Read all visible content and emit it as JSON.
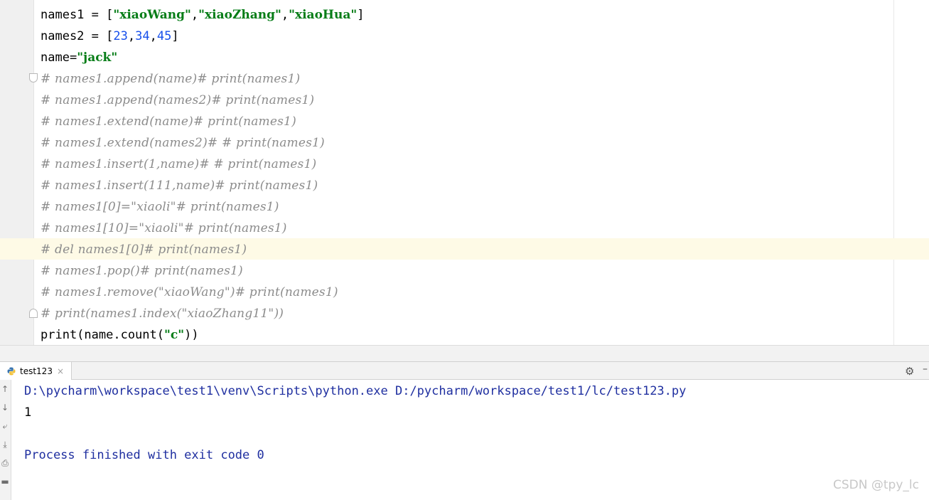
{
  "editor": {
    "lines": [
      {
        "parts": [
          {
            "t": "names1 = [",
            "c": ""
          },
          {
            "t": "\"xiaoWang\"",
            "c": "str"
          },
          {
            "t": ",",
            "c": ""
          },
          {
            "t": "\"xiaoZhang\"",
            "c": "str"
          },
          {
            "t": ",",
            "c": ""
          },
          {
            "t": "\"xiaoHua\"",
            "c": "str"
          },
          {
            "t": "]",
            "c": ""
          }
        ]
      },
      {
        "parts": [
          {
            "t": "names2 = [",
            "c": ""
          },
          {
            "t": "23",
            "c": "num"
          },
          {
            "t": ",",
            "c": ""
          },
          {
            "t": "34",
            "c": "num"
          },
          {
            "t": ",",
            "c": ""
          },
          {
            "t": "45",
            "c": "num"
          },
          {
            "t": "]",
            "c": ""
          }
        ]
      },
      {
        "parts": [
          {
            "t": "name=",
            "c": ""
          },
          {
            "t": "\"jack\"",
            "c": "str"
          }
        ]
      },
      {
        "parts": [
          {
            "t": "# names1.append(name)# print(names1)",
            "c": "comment"
          }
        ]
      },
      {
        "parts": [
          {
            "t": "# names1.append(names2)# print(names1)",
            "c": "comment"
          }
        ]
      },
      {
        "parts": [
          {
            "t": "# names1.extend(name)# print(names1)",
            "c": "comment"
          }
        ]
      },
      {
        "parts": [
          {
            "t": "# names1.extend(names2)# # print(names1)",
            "c": "comment"
          }
        ]
      },
      {
        "parts": [
          {
            "t": "# names1.insert(1,name)# # print(names1)",
            "c": "comment"
          }
        ]
      },
      {
        "parts": [
          {
            "t": "# names1.insert(111,name)# print(names1)",
            "c": "comment"
          }
        ]
      },
      {
        "parts": [
          {
            "t": "# names1[0]=\"xiaoli\"# print(names1)",
            "c": "comment"
          }
        ]
      },
      {
        "parts": [
          {
            "t": "# names1[10]=\"xiaoli\"# print(names1)",
            "c": "comment"
          }
        ]
      },
      {
        "parts": [
          {
            "t": "# del names1[0]# print(names1)",
            "c": "comment"
          }
        ]
      },
      {
        "parts": [
          {
            "t": "# names1.pop()# print(names1)",
            "c": "comment"
          }
        ]
      },
      {
        "parts": [
          {
            "t": "# names1.remove(\"xiaoWang\")# print(names1)",
            "c": "comment"
          }
        ]
      },
      {
        "parts": [
          {
            "t": "# print(names1.index(\"xiaoZhang11\"))",
            "c": "comment"
          }
        ]
      },
      {
        "parts": [
          {
            "t": "print(name.count(",
            "c": ""
          },
          {
            "t": "\"c\"",
            "c": "str"
          },
          {
            "t": "))",
            "c": ""
          }
        ]
      }
    ]
  },
  "run_panel": {
    "tab_label": "test123",
    "tab_close": "×",
    "icons": {
      "tab": "python-icon",
      "settings": "gear-icon",
      "hide": "minimize-icon"
    },
    "output": {
      "command": "D:\\pycharm\\workspace\\test1\\venv\\Scripts\\python.exe D:/pycharm/workspace/test1/lc/test123.py",
      "stdout": "1",
      "process": "Process finished with exit code 0"
    }
  },
  "watermark": "CSDN @tpy_lc",
  "colors": {
    "string": "#067d17",
    "number": "#1750eb",
    "comment": "#8c8c8c",
    "caret_line": "#fefae6",
    "console_text": "#1f2fa0"
  }
}
